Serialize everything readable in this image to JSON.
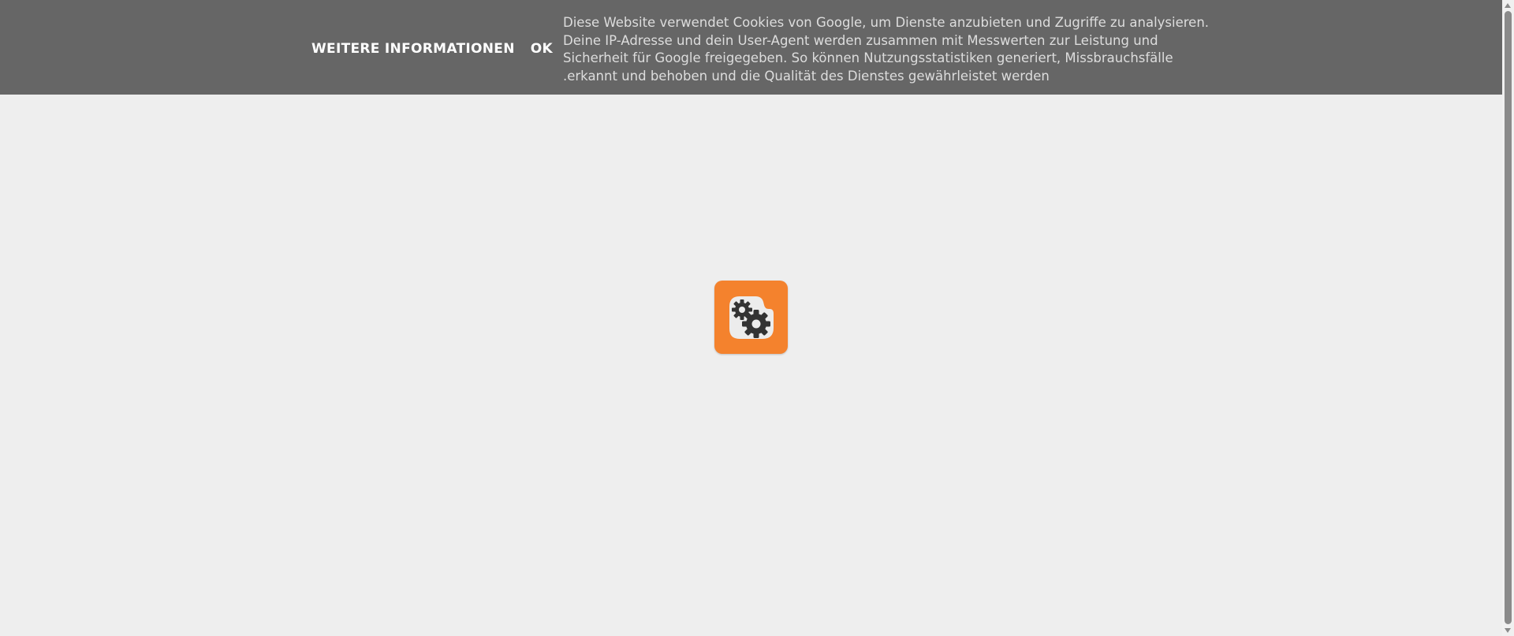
{
  "cookie_notice": {
    "more_info_label": "Weitere Informationen",
    "ok_label": "OK",
    "message_lines": [
      "Diese Website verwendet Cookies von Google, um Dienste anzubieten und Zugriffe zu analysieren.",
      "Deine IP-Adresse und dein User-Agent werden zusammen mit Messwerten zur Leistung und",
      "Sicherheit für Google freigegeben. So können Nutzungsstatistiken generiert, Missbrauchsfälle",
      ".erkannt und behoben und die Qualität des Dienstes gewährleistet werden"
    ]
  },
  "loading_icon": {
    "icon": "blogger-gears-icon",
    "color": "#f4822d"
  },
  "colors": {
    "banner_bg": "#666666",
    "page_bg": "#eeeeee",
    "accent": "#f4822d"
  }
}
